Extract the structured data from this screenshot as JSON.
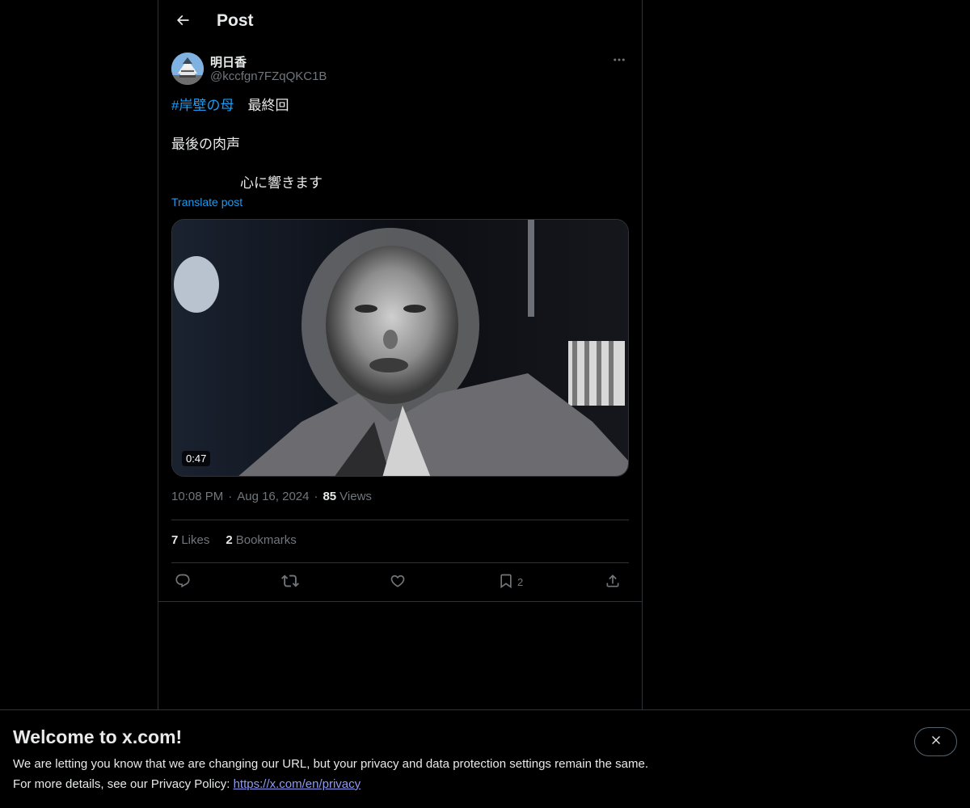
{
  "header": {
    "title": "Post"
  },
  "author": {
    "display_name": "明日香",
    "handle": "@kccfgn7FZqQKC1B"
  },
  "post": {
    "hashtag": "#岸壁の母",
    "line1_rest": "　最終回",
    "line2": "最後の肉声",
    "line3": "　　　　　心に響きます",
    "translate_label": "Translate post"
  },
  "media": {
    "duration": "0:47"
  },
  "meta": {
    "time": "10:08 PM",
    "date": "Aug 16, 2024",
    "views_count": "85",
    "views_label": "Views",
    "separator": "·"
  },
  "stats": {
    "likes_count": "7",
    "likes_label": "Likes",
    "bookmarks_count": "2",
    "bookmarks_label": "Bookmarks"
  },
  "actions": {
    "bookmark_count": "2"
  },
  "banner": {
    "title": "Welcome to x.com!",
    "text1": "We are letting you know that we are changing our URL, but your privacy and data protection settings remain the same.",
    "text2_prefix": "For more details, see our Privacy Policy: ",
    "link": "https://x.com/en/privacy"
  },
  "colors": {
    "background": "#000000",
    "text": "#e7e9ea",
    "muted": "#71767b",
    "accent": "#1d9bf0",
    "border": "#2f3336"
  }
}
